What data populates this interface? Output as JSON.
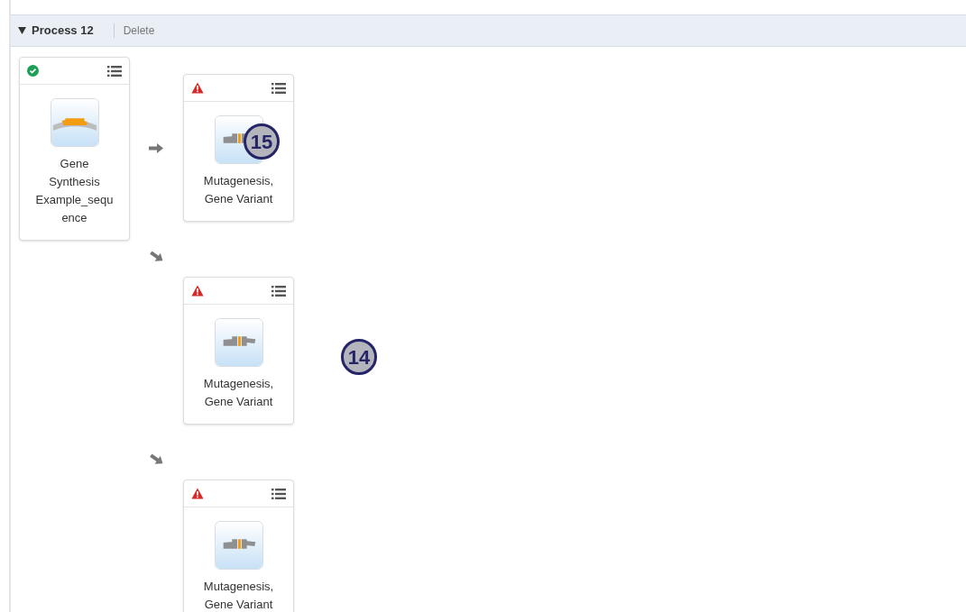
{
  "process": {
    "title": "Process 12",
    "expanded": true,
    "actions": [
      "Delete"
    ]
  },
  "source": {
    "error": false,
    "label": "Gene Synthesis Example_sequ ence"
  },
  "steps": [
    {
      "kind": "straight",
      "error": true,
      "label": "Mutagenesis, Gene Variant"
    },
    {
      "kind": "diagonal",
      "error": true,
      "label": "Mutagenesis, Gene Variant"
    },
    {
      "kind": "diagonal",
      "error": true,
      "label": "Mutagenesis, Gene Variant"
    }
  ],
  "callouts": [
    {
      "label": "15"
    },
    {
      "label": "14"
    }
  ]
}
